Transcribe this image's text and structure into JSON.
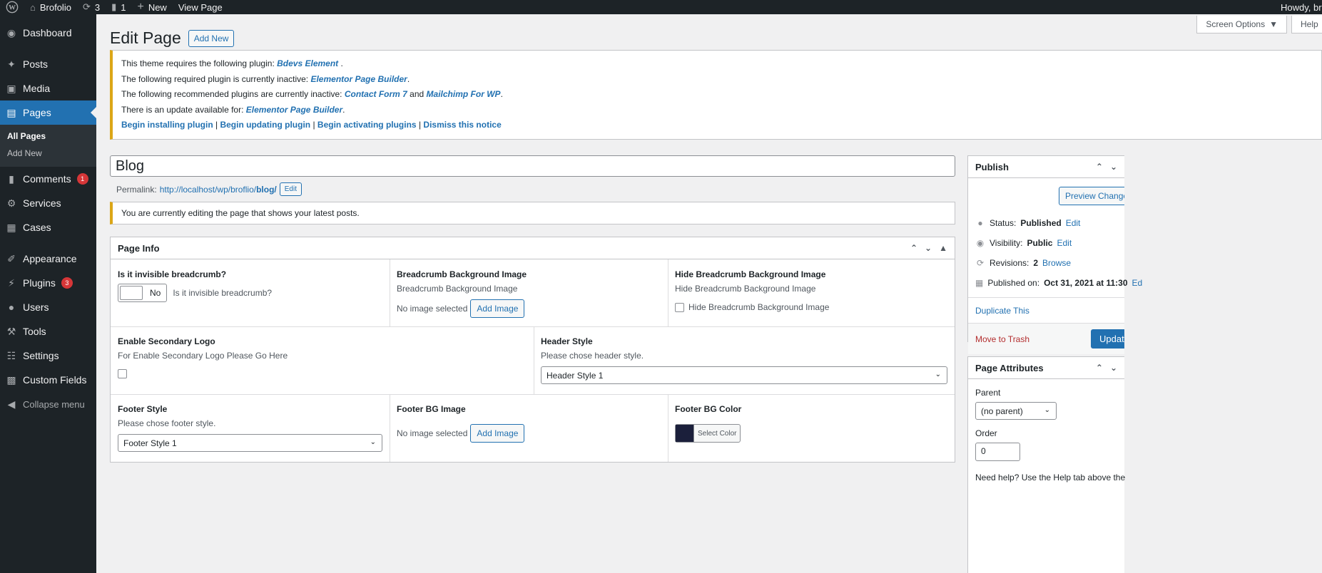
{
  "admin_bar": {
    "site_name": "Brofolio",
    "updates_count": "3",
    "comments_count": "1",
    "new_label": "New",
    "view_label": "View Page",
    "howdy": "Howdy, brofo"
  },
  "sidebar": {
    "dashboard": "Dashboard",
    "posts": "Posts",
    "media": "Media",
    "pages": "Pages",
    "all_pages": "All Pages",
    "add_new": "Add New",
    "comments": "Comments",
    "comments_badge": "1",
    "services": "Services",
    "cases": "Cases",
    "appearance": "Appearance",
    "plugins": "Plugins",
    "plugins_badge": "3",
    "users": "Users",
    "tools": "Tools",
    "settings": "Settings",
    "custom_fields": "Custom Fields",
    "collapse": "Collapse menu"
  },
  "screen_options": "Screen Options",
  "help": "Help",
  "page": {
    "heading": "Edit Page",
    "add_new": "Add New",
    "title_value": "Blog",
    "permalink_label": "Permalink:",
    "permalink_base": "http://localhost/wp/broflio/",
    "permalink_slug": "blog/",
    "permalink_edit": "Edit",
    "editing_notice": "You are currently editing the page that shows your latest posts."
  },
  "notice": {
    "line1_prefix": "This theme requires the following plugin: ",
    "line1_link": "Bdevs Element ",
    "line2_prefix": "The following required plugin is currently inactive: ",
    "line2_link": "Elementor Page Builder",
    "line3_prefix": "The following recommended plugins are currently inactive: ",
    "line3_link1": "Contact Form 7",
    "line3_and": " and ",
    "line3_link2": "Mailchimp For WP",
    "line4_prefix": "There is an update available for: ",
    "line4_link": "Elementor Page Builder",
    "act1": "Begin installing plugin",
    "act2": "Begin updating plugin",
    "act3": "Begin activating plugins",
    "act4": "Dismiss this notice"
  },
  "page_info": {
    "title": "Page Info",
    "inv_label": "Is it invisible breadcrumb?",
    "inv_toggle": "No",
    "inv_desc": "Is it invisible breadcrumb?",
    "bc_label": "Breadcrumb Background Image",
    "bc_desc": "Breadcrumb Background Image",
    "no_image": "No image selected",
    "add_image": "Add Image",
    "hide_label": "Hide Breadcrumb Background Image",
    "hide_desc": "Hide Breadcrumb Background Image",
    "hide_check": "Hide Breadcrumb Background Image",
    "sec_logo_label": "Enable Secondary Logo",
    "sec_logo_desc": "For Enable Secondary Logo Please Go Here",
    "header_label": "Header Style",
    "header_desc": "Please chose header style.",
    "header_value": "Header Style 1",
    "footer_label": "Footer Style",
    "footer_desc": "Please chose footer style.",
    "footer_value": "Footer Style 1",
    "footer_bg_label": "Footer BG Image",
    "footer_color_label": "Footer BG Color",
    "select_color": "Select Color",
    "swatch_color": "#1b1f3b"
  },
  "publish": {
    "title": "Publish",
    "preview": "Preview Changes",
    "status_label": "Status: ",
    "status_value": "Published",
    "visibility_label": "Visibility: ",
    "visibility_value": "Public",
    "revisions_label": "Revisions: ",
    "revisions_value": "2",
    "browse": "Browse",
    "published_label": "Published on: ",
    "published_value": "Oct 31, 2021 at 11:30",
    "edit": "Edit",
    "edit_short": "Ed",
    "duplicate": "Duplicate This",
    "trash": "Move to Trash",
    "update": "Update"
  },
  "attributes": {
    "title": "Page Attributes",
    "parent_label": "Parent",
    "parent_value": "(no parent)",
    "order_label": "Order",
    "order_value": "0",
    "help": "Need help? Use the Help tab above the"
  }
}
